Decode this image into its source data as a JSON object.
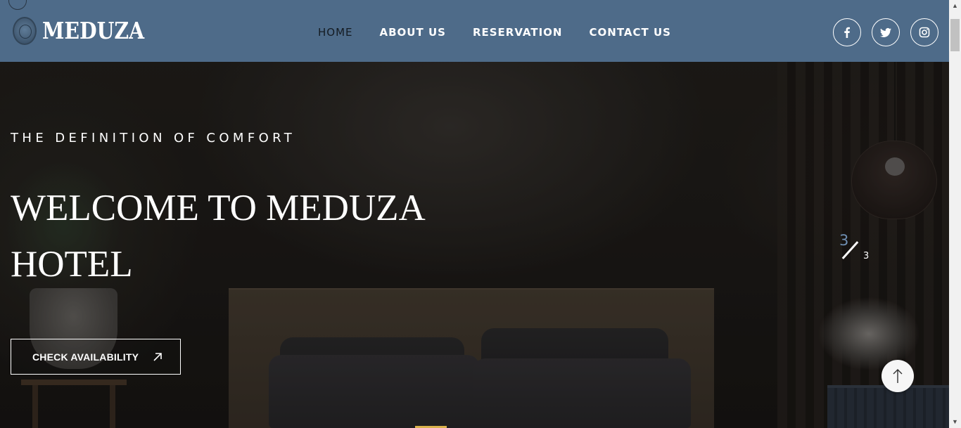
{
  "brand": {
    "name": "MEDUZA",
    "logo_icon": "medusa-head-icon"
  },
  "nav": {
    "items": [
      {
        "label": "HOME",
        "active": true
      },
      {
        "label": "ABOUT US",
        "active": false
      },
      {
        "label": "RESERVATION",
        "active": false
      },
      {
        "label": "CONTACT US",
        "active": false
      }
    ]
  },
  "socials": [
    {
      "icon": "facebook-icon"
    },
    {
      "icon": "twitter-icon"
    },
    {
      "icon": "instagram-icon"
    }
  ],
  "hero": {
    "tagline": "THE DEFINITION OF COMFORT",
    "headline_line1": "WELCOME TO MEDUZA",
    "headline_line2": "HOTEL",
    "cta_label": "CHECK AVAILABILITY",
    "cta_icon": "arrow-up-right-icon"
  },
  "slider": {
    "current": "3",
    "total": "3"
  },
  "colors": {
    "header_bg": "#4e6b89",
    "accent": "#6f8fb3",
    "active_nav": "#141b22"
  },
  "back_to_top": {
    "icon": "arrow-up-icon"
  }
}
